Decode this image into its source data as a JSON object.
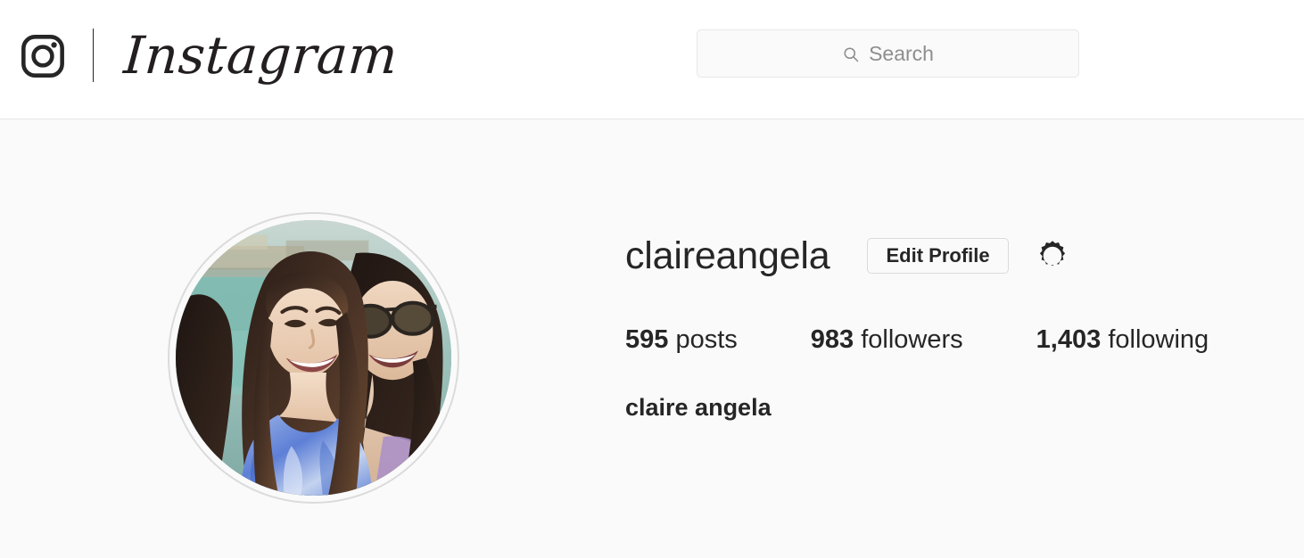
{
  "header": {
    "logo_icon": "instagram-camera-icon",
    "wordmark": "Instagram",
    "search": {
      "icon": "search-icon",
      "placeholder": "Search",
      "value": ""
    }
  },
  "profile": {
    "avatar_alt": "two smiling women outdoors",
    "username": "claireangela",
    "edit_profile_label": "Edit Profile",
    "settings_icon": "gear-icon",
    "stats": [
      {
        "name": "posts",
        "count": "595",
        "label": "posts"
      },
      {
        "name": "followers",
        "count": "983",
        "label": "followers"
      },
      {
        "name": "following",
        "count": "1,403",
        "label": "following"
      }
    ],
    "full_name": "claire angela"
  },
  "colors": {
    "text_primary": "#262626",
    "text_muted": "#8e8e8e",
    "border": "#dbdbdb",
    "page_bg": "#fafafa",
    "header_bg": "#ffffff"
  }
}
